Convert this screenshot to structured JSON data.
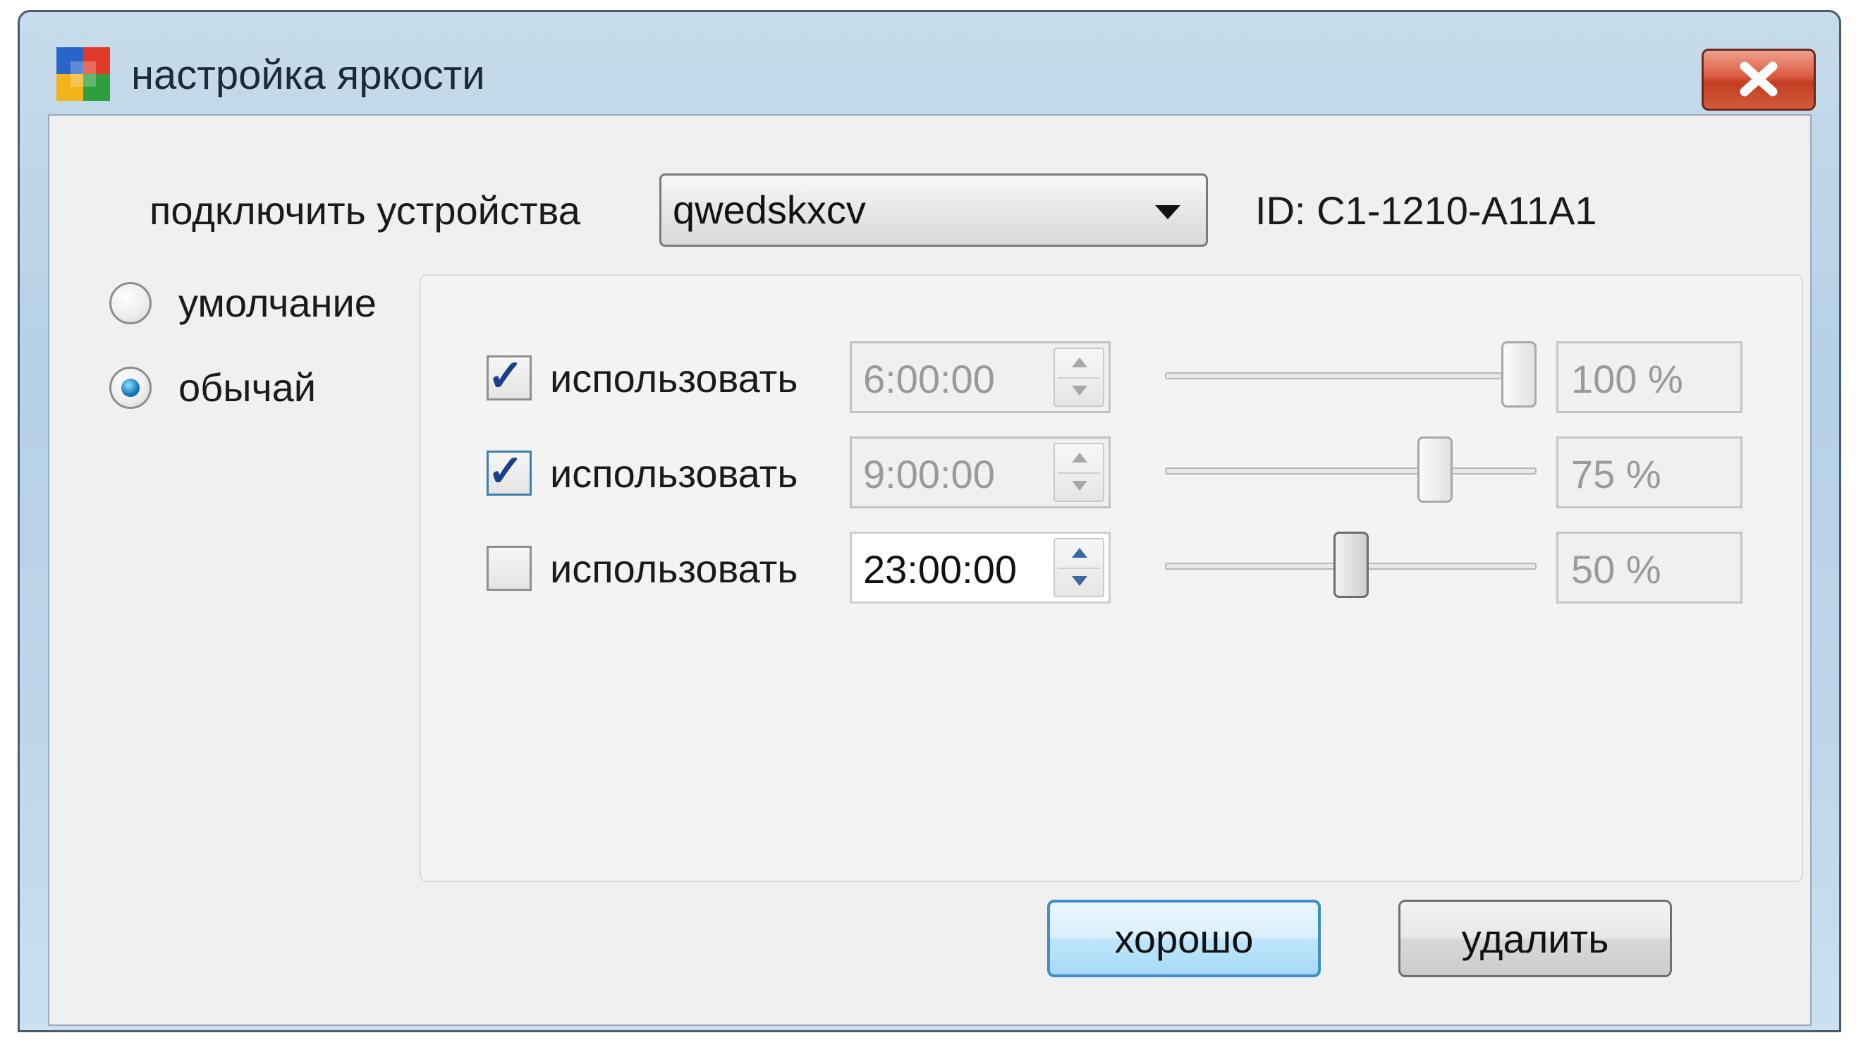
{
  "window": {
    "title": "настройка яркости"
  },
  "device": {
    "label": "подключить устройства",
    "selected": "qwedskxcv",
    "id_text": "ID: C1-1210-A11A1"
  },
  "mode": {
    "options": [
      {
        "label": "умолчание",
        "selected": false
      },
      {
        "label": "обычай",
        "selected": true
      }
    ]
  },
  "schedule": {
    "rows": [
      {
        "checked": true,
        "label": "использовать",
        "time": "6:00:00",
        "time_enabled": false,
        "brightness_fraction": 1.0,
        "percent_text": "100 %"
      },
      {
        "checked": true,
        "label": "использовать",
        "time": "9:00:00",
        "time_enabled": false,
        "brightness_fraction": 0.75,
        "percent_text": "75 %"
      },
      {
        "checked": false,
        "label": "использовать",
        "time": "23:00:00",
        "time_enabled": true,
        "brightness_fraction": 0.5,
        "percent_text": "50 %"
      }
    ]
  },
  "buttons": {
    "ok_label": "хорошо",
    "delete_label": "удалить"
  },
  "icons": {
    "app": "app-logo-icon",
    "close": "close-icon",
    "dropdown": "chevron-down-icon",
    "spin_up": "arrow-up-icon",
    "spin_down": "arrow-down-icon"
  },
  "colors": {
    "accent": "#3d8fc7",
    "close_button": "#d2472b",
    "title_bar": "#b6d0e6"
  }
}
